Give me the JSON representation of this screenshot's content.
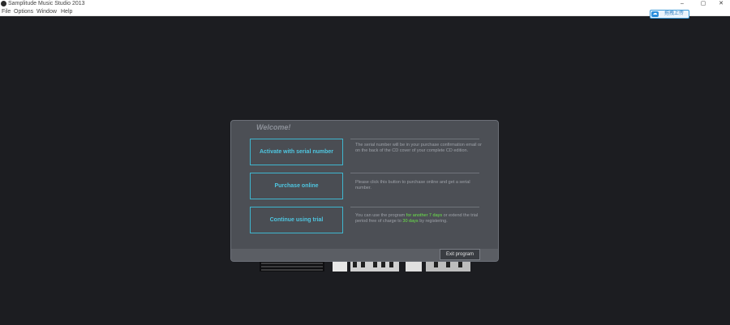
{
  "window": {
    "title": "Samplitude Music Studio 2013",
    "minimize": "–",
    "maximize": "▢",
    "close": "✕"
  },
  "menu": {
    "file": "File",
    "options": "Options",
    "window": "Window",
    "help": "Help"
  },
  "upload_badge": {
    "label": "拖拽上传",
    "icon": "cloud-upload-icon"
  },
  "dialog": {
    "title": "Welcome!",
    "activate": {
      "label": "Activate with serial number",
      "desc": "The serial number will be in your purchase confirmation email or on the back of the CD cover of your complete CD edition."
    },
    "purchase": {
      "label": "Purchase online",
      "desc": "Please click this button to purchase online and get a serial number."
    },
    "trial": {
      "label": "Continue using trial",
      "desc_prefix": "You can use the program ",
      "desc_green1": "for another 7 days",
      "desc_mid": " or extend the trial period free of charge to ",
      "desc_green2": "30 days",
      "desc_suffix": " by registering."
    },
    "exit": "Exit program"
  },
  "colors": {
    "accent": "#3fb6cf",
    "accent_text": "#4fc6e0",
    "highlight": "#6be34a",
    "background": "#1c1d21",
    "dialog": "#4c4f55"
  }
}
